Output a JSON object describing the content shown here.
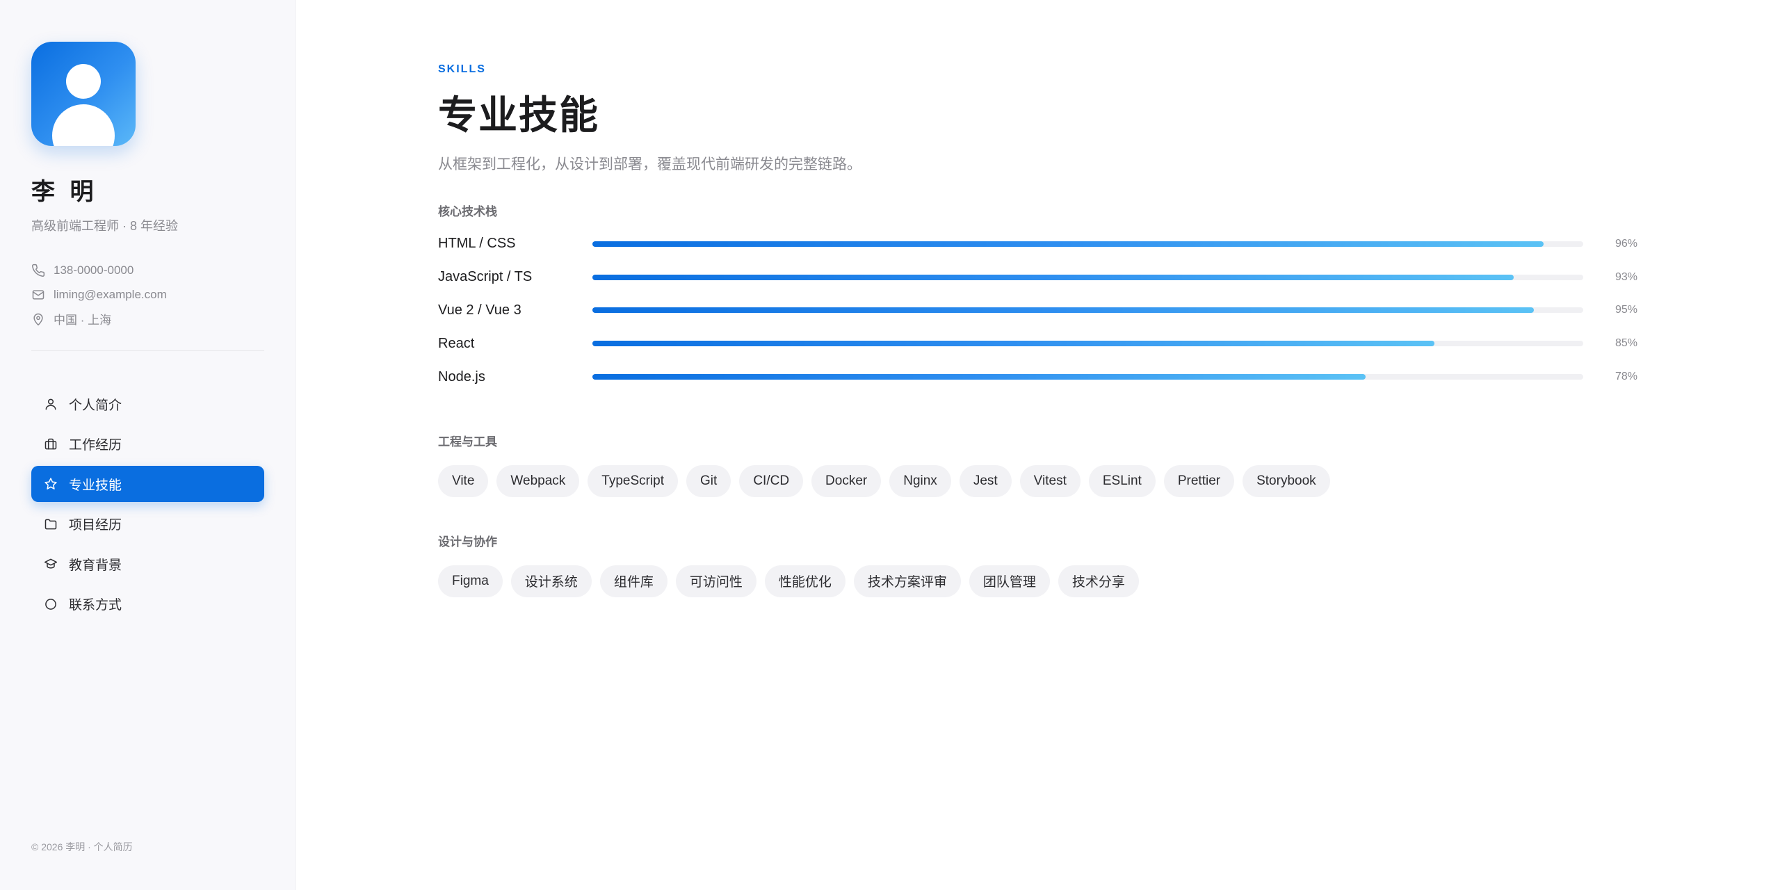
{
  "profile": {
    "name": "李 明",
    "title": "高级前端工程师 · 8 年经验",
    "avatar_icon": "user-avatar-icon",
    "contacts": [
      {
        "icon": "phone-icon",
        "text": "138-0000-0000"
      },
      {
        "icon": "mail-icon",
        "text": "liming@example.com"
      },
      {
        "icon": "location-pin-icon",
        "text": "中国 · 上海"
      }
    ]
  },
  "nav": [
    {
      "icon": "user-icon",
      "label": "个人简介",
      "active": false
    },
    {
      "icon": "briefcase-icon",
      "label": "工作经历",
      "active": false
    },
    {
      "icon": "star-icon",
      "label": "专业技能",
      "active": true
    },
    {
      "icon": "folder-icon",
      "label": "项目经历",
      "active": false
    },
    {
      "icon": "graduation-cap-icon",
      "label": "教育背景",
      "active": false
    },
    {
      "icon": "circle-icon",
      "label": "联系方式",
      "active": false
    }
  ],
  "footer": "© 2026 李明 · 个人简历",
  "section": {
    "eyebrow": "SKILLS",
    "title": "专业技能",
    "subtitle": "从框架到工程化，从设计到部署，覆盖现代前端研发的完整链路。"
  },
  "core": {
    "label": "核心技术栈",
    "skills": [
      {
        "name": "HTML / CSS",
        "percent": 96,
        "percent_label": "96%"
      },
      {
        "name": "JavaScript / TS",
        "percent": 93,
        "percent_label": "93%"
      },
      {
        "name": "Vue 2 / Vue 3",
        "percent": 95,
        "percent_label": "95%"
      },
      {
        "name": "React",
        "percent": 85,
        "percent_label": "85%"
      },
      {
        "name": "Node.js",
        "percent": 78,
        "percent_label": "78%"
      }
    ]
  },
  "tools": {
    "label": "工程与工具",
    "items": [
      "Vite",
      "Webpack",
      "TypeScript",
      "Git",
      "CI/CD",
      "Docker",
      "Nginx",
      "Jest",
      "Vitest",
      "ESLint",
      "Prettier",
      "Storybook"
    ]
  },
  "design": {
    "label": "设计与协作",
    "items": [
      "Figma",
      "设计系统",
      "组件库",
      "可访问性",
      "性能优化",
      "技术方案评审",
      "团队管理",
      "技术分享"
    ]
  },
  "colors": {
    "accent": "#0a6ee0",
    "accent_light": "#5bc2f5",
    "chip_bg": "#f2f2f5",
    "sidebar_bg": "#f8f8fb"
  }
}
